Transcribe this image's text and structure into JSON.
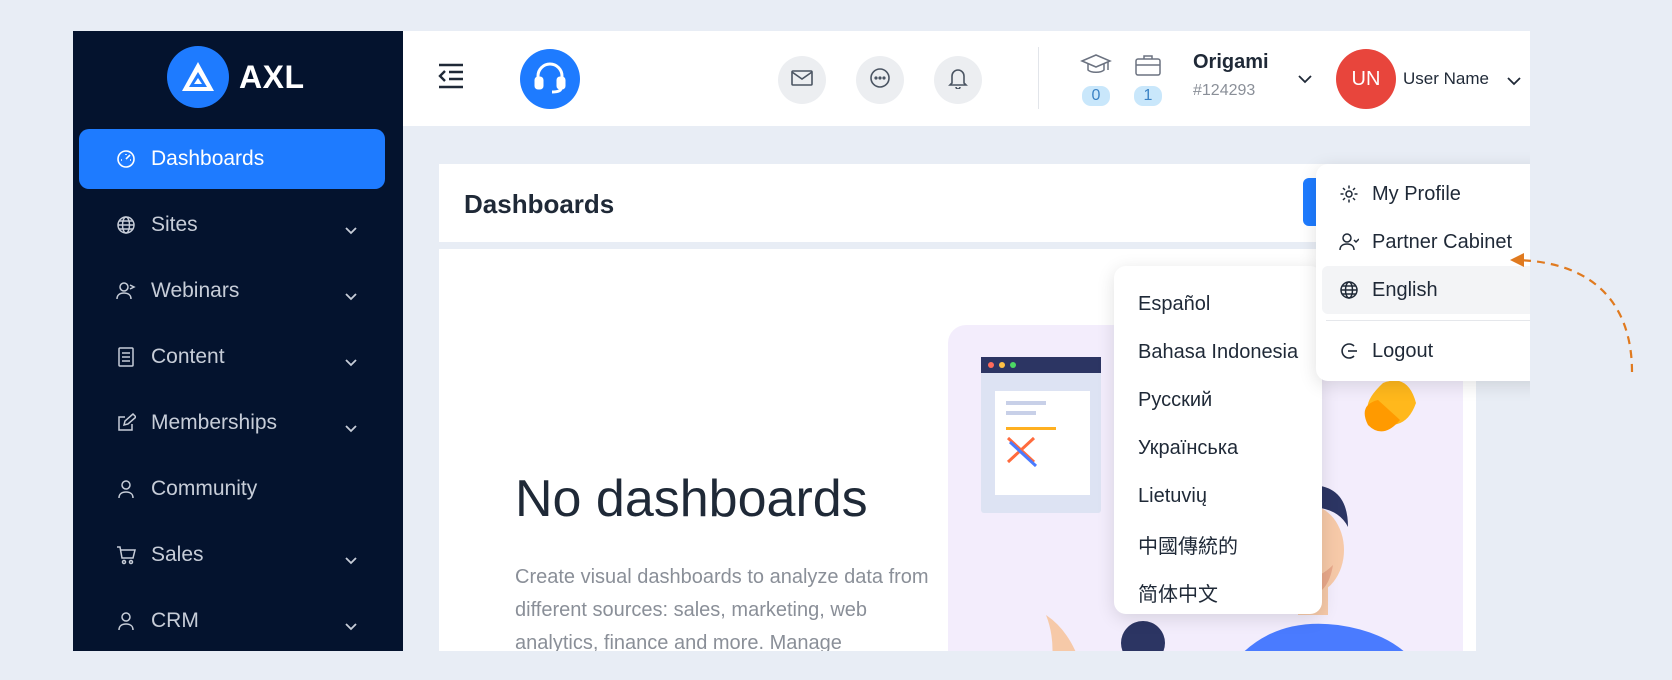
{
  "sidebar": {
    "logo_text": "AXL",
    "items": [
      {
        "label": "Dashboards",
        "icon": "dashboard-icon",
        "active": true,
        "has_children": false
      },
      {
        "label": "Sites",
        "icon": "globe-icon",
        "has_children": true
      },
      {
        "label": "Webinars",
        "icon": "webinar-icon",
        "has_children": true
      },
      {
        "label": "Content",
        "icon": "document-icon",
        "has_children": true
      },
      {
        "label": "Memberships",
        "icon": "edit-icon",
        "has_children": true
      },
      {
        "label": "Community",
        "icon": "user-icon",
        "has_children": false
      },
      {
        "label": "Sales",
        "icon": "cart-icon",
        "has_children": true
      },
      {
        "label": "CRM",
        "icon": "user-icon",
        "has_children": true
      }
    ]
  },
  "topbar": {
    "courses_count": "0",
    "products_count": "1",
    "org_name": "Origami",
    "org_id": "#124293",
    "avatar_initials": "UN",
    "user_name": "User Name"
  },
  "main": {
    "page_title": "Dashboards",
    "empty_title": "No dashboards",
    "empty_desc": "Create visual dashboards to analyze data from different sources: sales, marketing, web analytics, finance and more. Manage"
  },
  "profile_menu": {
    "items": [
      {
        "label": "My Profile",
        "icon": "gear-icon"
      },
      {
        "label": "Partner Cabinet",
        "icon": "partner-icon"
      },
      {
        "label": "English",
        "icon": "globe-icon",
        "has_submenu": true
      },
      {
        "label": "Logout",
        "icon": "logout-icon"
      }
    ]
  },
  "language_menu": {
    "items": [
      "Español",
      "Bahasa Indonesia",
      "Русский",
      "Українська",
      "Lietuvių",
      "中國傳統的",
      "简体中文"
    ]
  },
  "colors": {
    "accent": "#1e7bff",
    "sidebar_bg": "#04132e",
    "avatar_bg": "#e8453c",
    "annotation": "#e07a1f"
  }
}
